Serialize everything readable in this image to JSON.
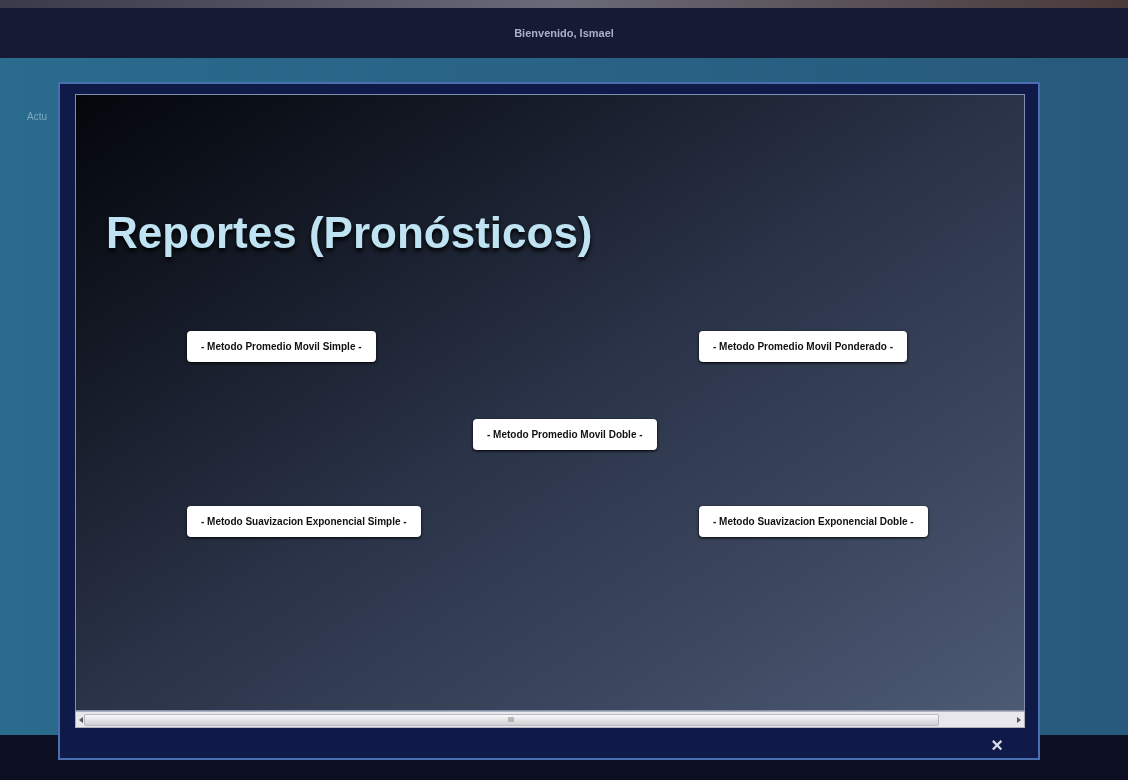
{
  "header": {
    "greeting": "Bienvenido, Ismael"
  },
  "sidebar_text": "Actu",
  "dialog": {
    "title": "Reportes (Pronósticos)",
    "methods": [
      {
        "label": "- Metodo Promedio Movil Simple -"
      },
      {
        "label": "- Metodo Promedio Movil Ponderado -"
      },
      {
        "label": "- Metodo Promedio Movil Doble -"
      },
      {
        "label": "- Metodo Suavizacion Exponencial Simple -"
      },
      {
        "label": "- Metodo Suavizacion Exponencial Doble -"
      }
    ],
    "close": "×"
  }
}
